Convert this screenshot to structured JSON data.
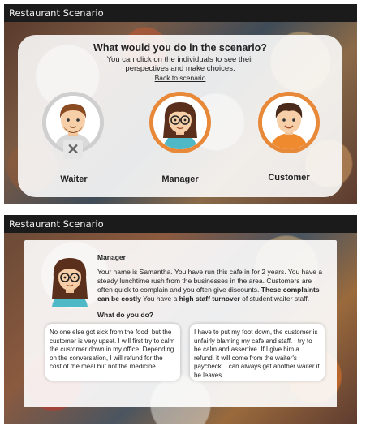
{
  "frame1": {
    "window_title": "Restaurant Scenario",
    "heading": "What would you do in the scenario?",
    "subheading": "You can click on the individuals to see their perspectives and make choices.",
    "back_link": "Back to scenario",
    "characters": [
      {
        "label": "Waiter",
        "ring_color": "#cfcfcf",
        "badge": "✕"
      },
      {
        "label": "Manager",
        "ring_color": "#e8893a"
      },
      {
        "label": "Customer",
        "ring_color": "#e8893a"
      }
    ]
  },
  "frame2": {
    "window_title": "Restaurant Scenario",
    "role": "Manager",
    "bio_part1": "Your name is Samantha. You have run this cafe in for 2 years. You have a steady lunchtime rush from the businesses in the area. Customers are often quick to complain and you often give discounts. ",
    "bio_bold1": "These complaints can be costly",
    "bio_part2": "  You have a ",
    "bio_bold2": "high staff  turnover",
    "bio_part3": " of student waiter staff.",
    "question": "What do you do?",
    "choices": [
      "No one else got sick from the food, but the customer is very upset. I will first try to calm the customer down in my office. Depending on the conversation, I will refund for the cost of the meal but not the medicine.",
      "I have to put my foot down, the customer is unfairly blaming my cafe and staff. I try to be calm and assertive. If I give him a refund, it will come from the waiter's paycheck. I can always get another waiter if he leaves."
    ]
  },
  "colors": {
    "accent_orange": "#e8893a",
    "titlebar": "#1b1b1b"
  }
}
